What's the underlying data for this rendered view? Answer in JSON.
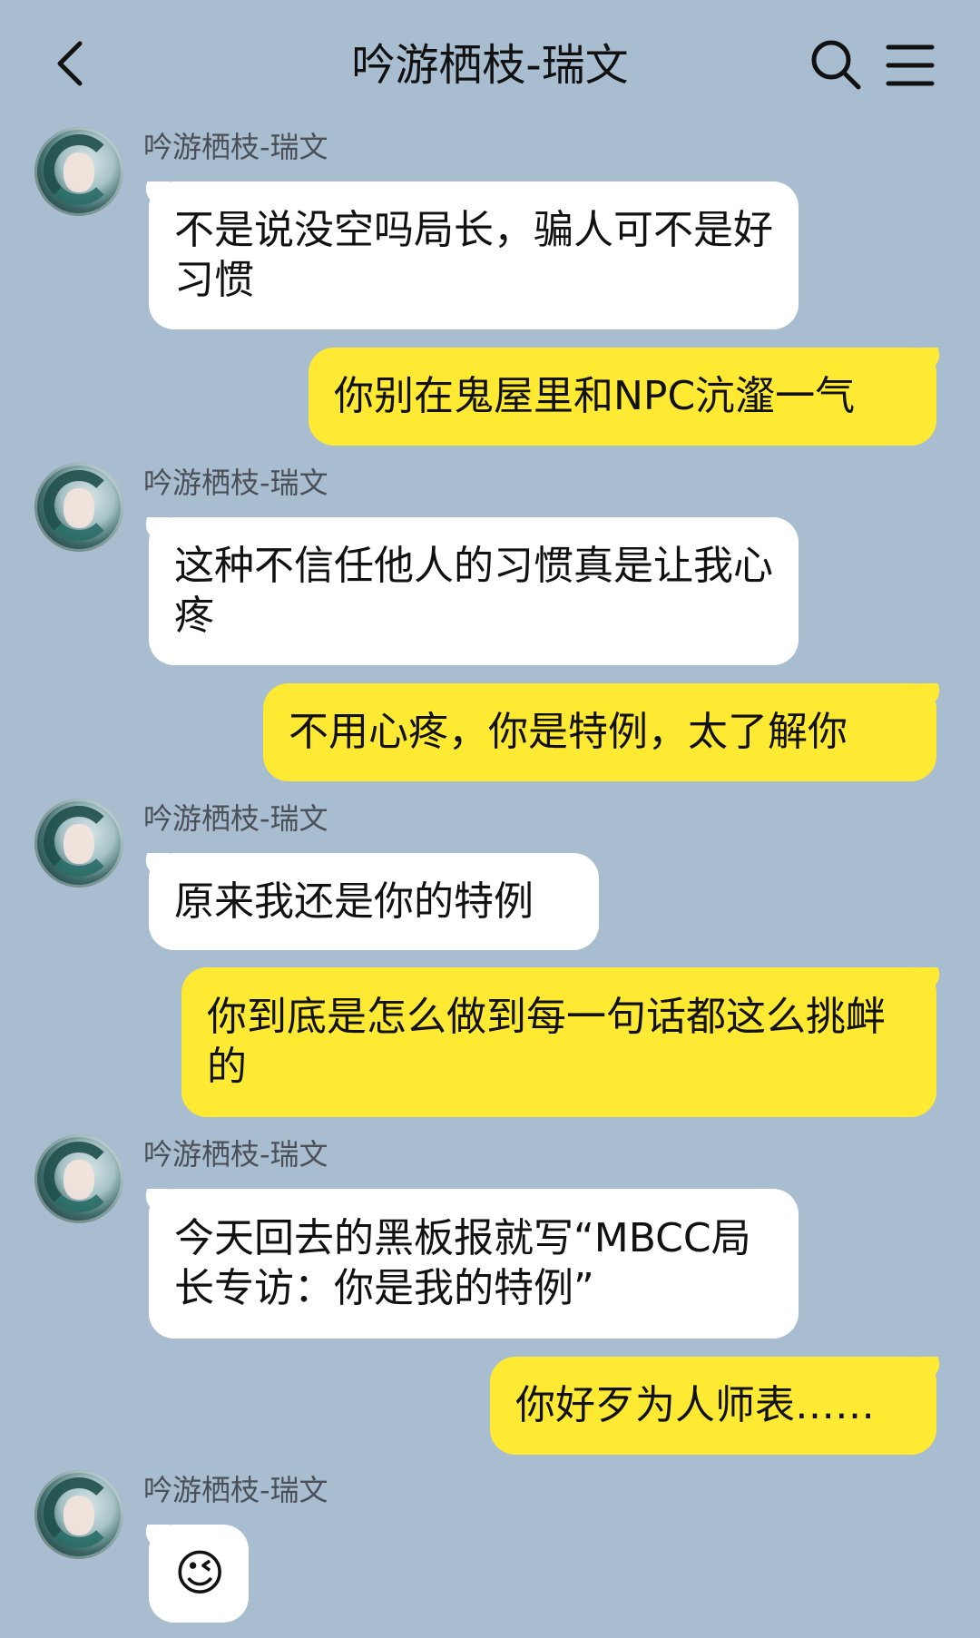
{
  "header": {
    "title": "吟游栖枝-瑞文",
    "back_icon": "chevron-left-icon",
    "search_icon": "search-icon",
    "menu_icon": "menu-icon"
  },
  "colors": {
    "background": "#a9bdd0",
    "incoming_bubble": "#ffffff",
    "outgoing_bubble": "#ffea33"
  },
  "messages": [
    {
      "side": "left",
      "sender": "吟游栖枝-瑞文",
      "text": "不是说没空吗局长，骗人可不是好习惯"
    },
    {
      "side": "right",
      "text": "你别在鬼屋里和NPC沆瀣一气"
    },
    {
      "side": "left",
      "sender": "吟游栖枝-瑞文",
      "text": "这种不信任他人的习惯真是让我心疼"
    },
    {
      "side": "right",
      "text": "不用心疼，你是特例，太了解你"
    },
    {
      "side": "left",
      "sender": "吟游栖枝-瑞文",
      "text": "原来我还是你的特例"
    },
    {
      "side": "right",
      "text": "你到底是怎么做到每一句话都这么挑衅的"
    },
    {
      "side": "left",
      "sender": "吟游栖枝-瑞文",
      "text": "今天回去的黑板报就写“MBCC局长专访：你是我的特例”"
    },
    {
      "side": "right",
      "text": "你好歹为人师表……"
    },
    {
      "side": "left",
      "sender": "吟游栖枝-瑞文",
      "text": "😉"
    }
  ]
}
